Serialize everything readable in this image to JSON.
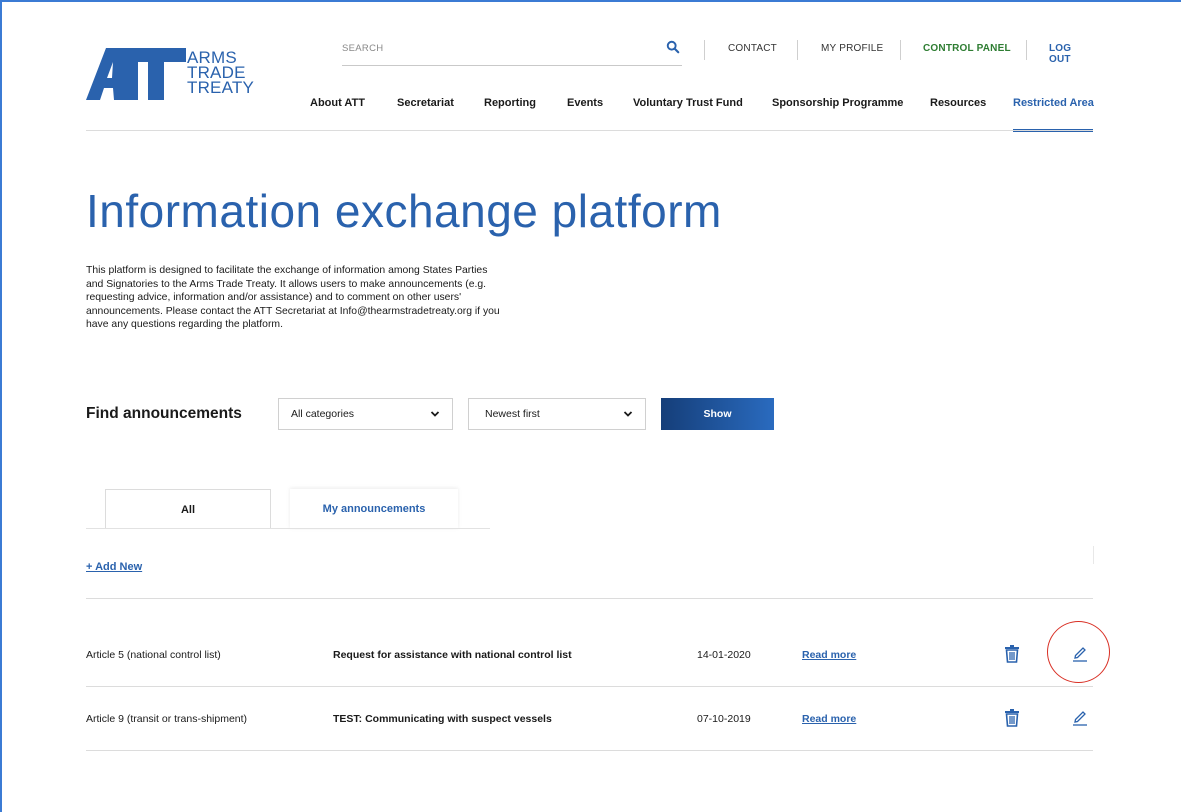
{
  "logo": {
    "mark": "ATT",
    "line1": "ARMS",
    "line2": "TRADE",
    "line3": "TREATY",
    "brand_color": "#2a62ad"
  },
  "search": {
    "placeholder": "SEARCH",
    "icon": "search-icon"
  },
  "utility_links": [
    {
      "label": "CONTACT",
      "color": "#333333"
    },
    {
      "label": "MY PROFILE",
      "color": "#333333"
    },
    {
      "label": "CONTROL PANEL",
      "color": "#2e7d32"
    },
    {
      "label": "LOG OUT",
      "color": "#2a62ad"
    }
  ],
  "nav": [
    {
      "label": "About ATT"
    },
    {
      "label": "Secretariat"
    },
    {
      "label": "Reporting"
    },
    {
      "label": "Events"
    },
    {
      "label": "Voluntary Trust Fund"
    },
    {
      "label": "Sponsorship Programme"
    },
    {
      "label": "Resources"
    },
    {
      "label": "Restricted Area",
      "active": true
    }
  ],
  "main": {
    "title": "Information exchange platform",
    "intro": "This platform is designed to facilitate the exchange of information among States Parties and Signatories to the Arms Trade Treaty. It allows users to make announcements (e.g. requesting advice, information and/or assistance) and to comment on other users' announcements. Please contact the ATT Secretariat at Info@thearmstradetreaty.org if you have any questions regarding the platform."
  },
  "filters": {
    "label": "Find announcements",
    "category_select": "All categories",
    "sort_select": "Newest first",
    "show_button": "Show"
  },
  "tabs": [
    {
      "label": "All"
    },
    {
      "label": "My announcements",
      "active": true
    }
  ],
  "add_new": "+ Add New",
  "announcements": [
    {
      "category": "Article 5 (national control list)",
      "title": "Request for assistance with national control list",
      "date": "14-01-2020",
      "read_more": "Read more"
    },
    {
      "category": "Article 9 (transit or trans-shipment)",
      "title": "TEST: Communicating with suspect vessels",
      "date": "07-10-2019",
      "read_more": "Read more"
    }
  ],
  "colors": {
    "accent": "#2a62ad",
    "highlight": "#d93025"
  }
}
